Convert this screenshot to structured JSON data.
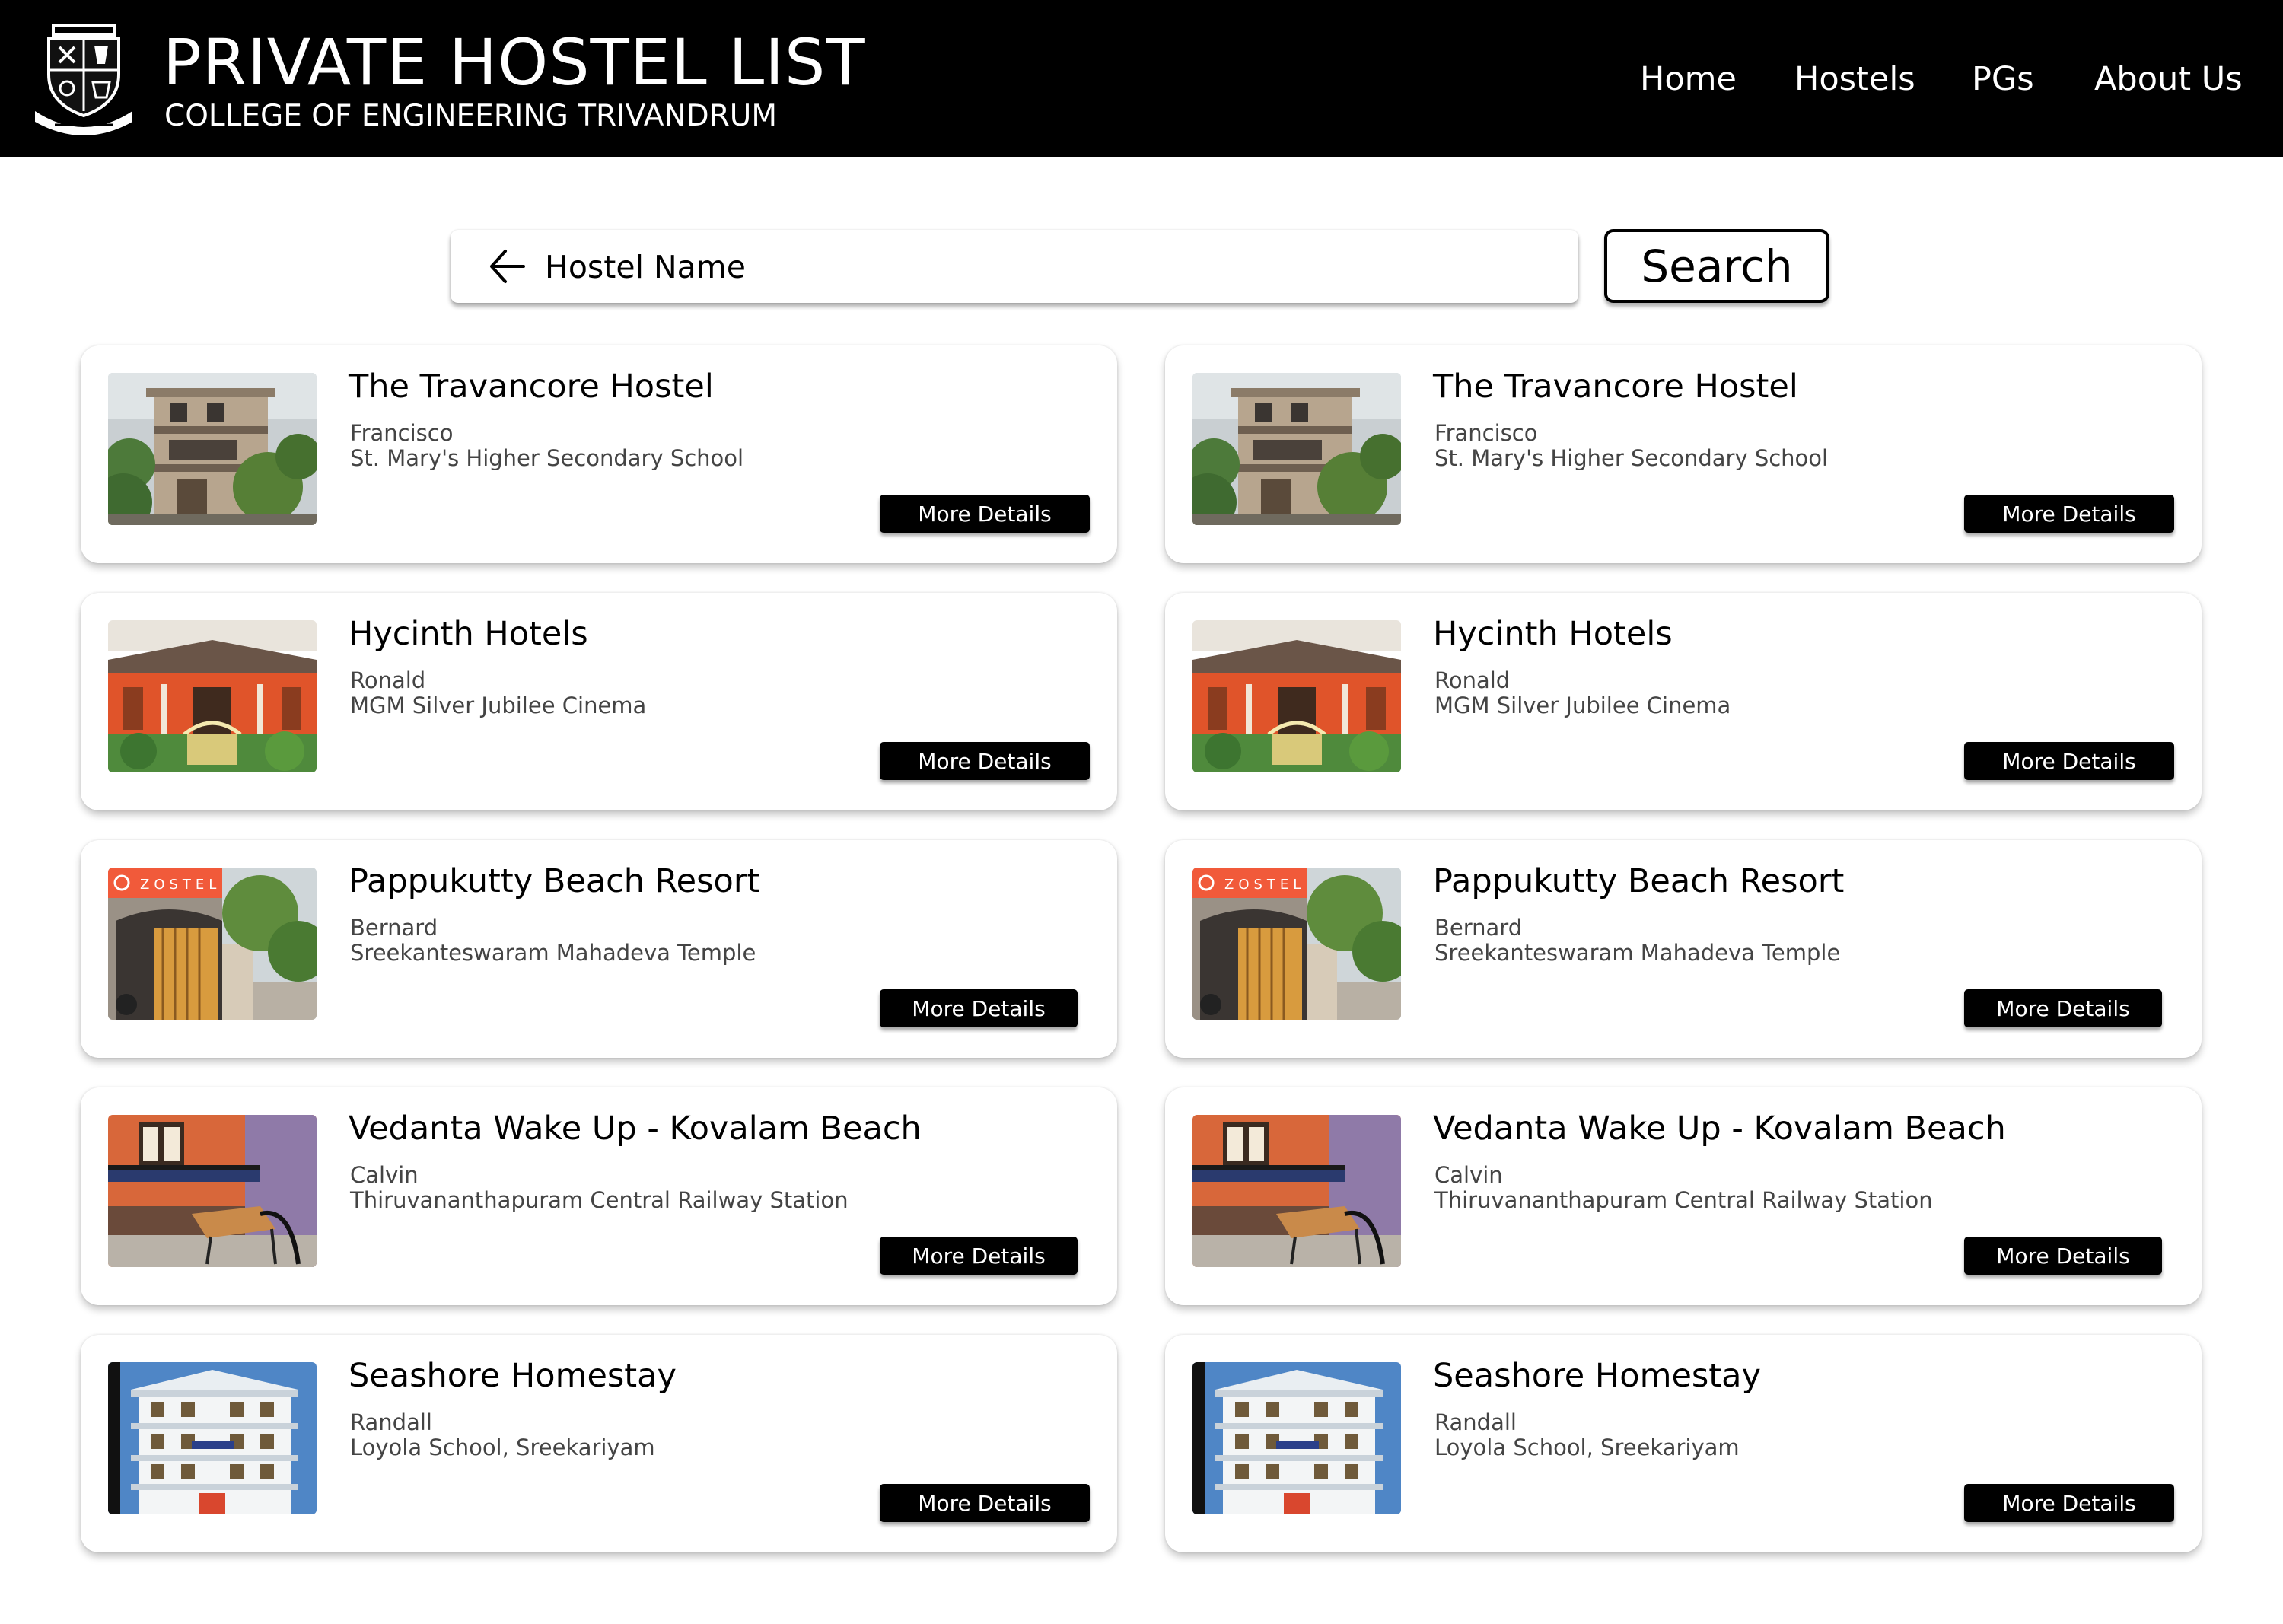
{
  "header": {
    "title": "PRIVATE HOSTEL LIST",
    "subtitle": "COLLEGE OF ENGINEERING TRIVANDRUM",
    "nav": [
      {
        "label": "Home"
      },
      {
        "label": "Hostels"
      },
      {
        "label": "PGs"
      },
      {
        "label": "About Us"
      }
    ]
  },
  "search": {
    "placeholder": "Hostel Name",
    "button_label": "Search"
  },
  "listings": [
    {
      "name": "The Travancore Hostel",
      "owner": "Francisco",
      "landmark": "St. Mary's Higher Secondary School",
      "button": "More Details",
      "image": "hostel-building-photo"
    },
    {
      "name": "The Travancore Hostel",
      "owner": "Francisco",
      "landmark": "St. Mary's Higher Secondary School",
      "button": "More Details",
      "image": "hostel-building-photo"
    },
    {
      "name": "Hycinth Hotels",
      "owner": "Ronald",
      "landmark": "MGM Silver Jubilee Cinema",
      "button": "More Details",
      "image": "orange-house-photo"
    },
    {
      "name": "Hycinth Hotels",
      "owner": "Ronald",
      "landmark": "MGM Silver Jubilee Cinema",
      "button": "More Details",
      "image": "orange-house-photo"
    },
    {
      "name": "Pappukutty Beach Resort",
      "owner": "Bernard",
      "landmark": "Sreekanteswaram Mahadeva Temple",
      "button": "More Details",
      "image": "zostel-gate-photo",
      "sign": "ZOSTEL"
    },
    {
      "name": "Pappukutty Beach Resort",
      "owner": "Bernard",
      "landmark": "Sreekanteswaram Mahadeva Temple",
      "button": "More Details",
      "image": "zostel-gate-photo",
      "sign": "ZOSTEL"
    },
    {
      "name": "Vedanta Wake Up - Kovalam Beach",
      "owner": "Calvin",
      "landmark": "Thiruvananthapuram Central Railway Station",
      "button": "More Details",
      "image": "dorm-room-photo"
    },
    {
      "name": "Vedanta Wake Up - Kovalam Beach",
      "owner": "Calvin",
      "landmark": "Thiruvananthapuram Central Railway Station",
      "button": "More Details",
      "image": "dorm-room-photo"
    },
    {
      "name": "Seashore Homestay",
      "owner": "Randall",
      "landmark": "Loyola School, Sreekariyam",
      "button": "More Details",
      "image": "white-building-photo"
    },
    {
      "name": "Seashore Homestay",
      "owner": "Randall",
      "landmark": "Loyola School, Sreekariyam",
      "button": "More Details",
      "image": "white-building-photo"
    }
  ]
}
